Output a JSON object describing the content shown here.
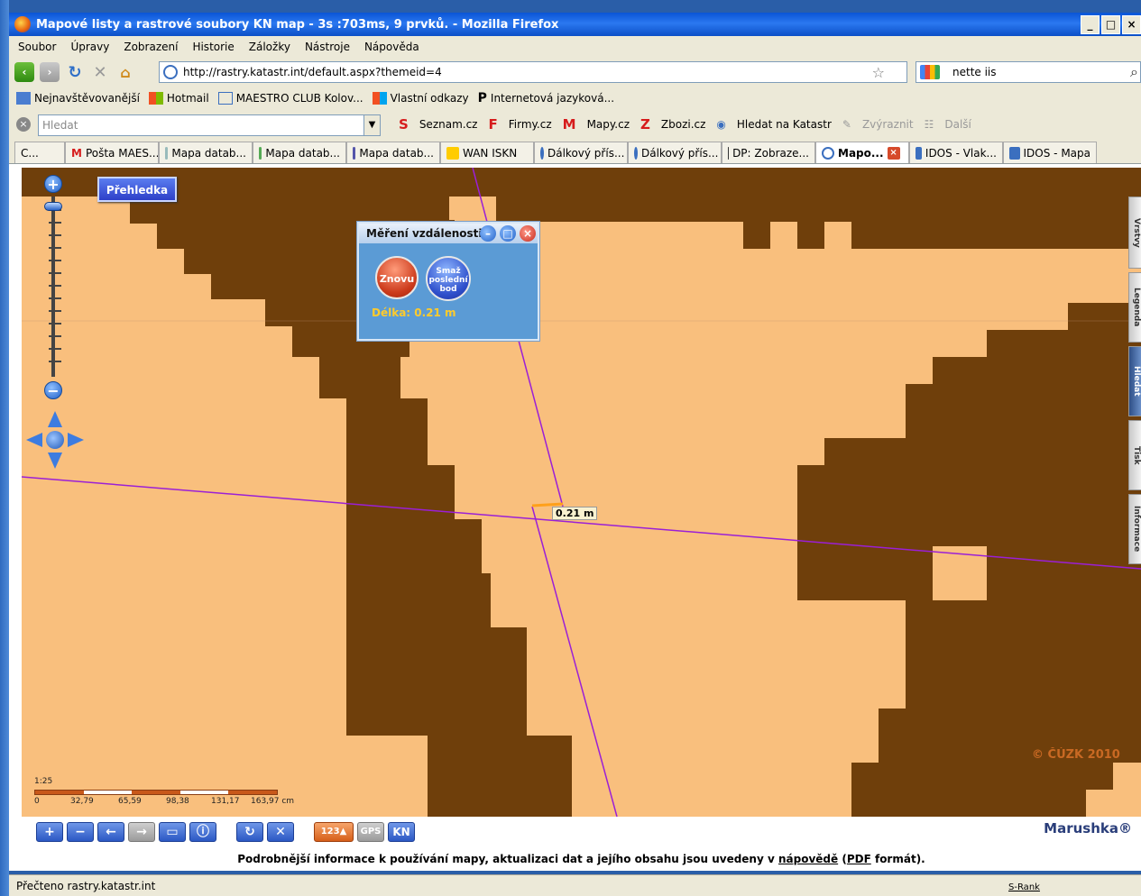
{
  "window": {
    "title": "Mapové listy a rastrové soubory KN map - 3s :703ms, 9 prvků. - Mozilla Firefox",
    "controls": [
      "_",
      "□",
      "×"
    ]
  },
  "menu": [
    "Soubor",
    "Úpravy",
    "Zobrazení",
    "Historie",
    "Záložky",
    "Nástroje",
    "Nápověda"
  ],
  "nav": {
    "url": "http://rastry.katastr.int/default.aspx?themeid=4",
    "search_value": "nette iis"
  },
  "bookmarks": [
    "Nejnavštěvovanější",
    "Hotmail",
    "MAESTRO CLUB Kolov...",
    "Vlastní odkazy",
    "Internetová jazyková..."
  ],
  "toolbar2": {
    "search_placeholder": "Hledat",
    "items": [
      "Seznam.cz",
      "Firmy.cz",
      "Mapy.cz",
      "Zbozi.cz",
      "Hledat na Katastr",
      "Zvýraznit",
      "Další"
    ]
  },
  "tabs": [
    {
      "label": "C...",
      "active": false
    },
    {
      "label": "Pošta MAES...",
      "active": false
    },
    {
      "label": "Mapa datab...",
      "active": false
    },
    {
      "label": "Mapa datab...",
      "active": false
    },
    {
      "label": "Mapa datab...",
      "active": false
    },
    {
      "label": "WAN ISKN",
      "active": false
    },
    {
      "label": "Dálkový přís...",
      "active": false
    },
    {
      "label": "Dálkový přís...",
      "active": false
    },
    {
      "label": "DP: Zobraze...",
      "active": false
    },
    {
      "label": "Mapo...",
      "active": true
    },
    {
      "label": "IDOS - Vlak...",
      "active": false
    },
    {
      "label": "IDOS - Mapa",
      "active": false
    }
  ],
  "map": {
    "overview_button": "Přehledka",
    "measure_panel": {
      "title": "Měření vzdálenosti",
      "again_button": "Znovu",
      "delete_last_button": "Smaž poslední bod",
      "length_text": "Délka: 0.21 m"
    },
    "measure_label": "0.21 m",
    "scale": {
      "ratio": "1:25",
      "labels": [
        "0",
        "32,79",
        "65,59",
        "98,38",
        "131,17",
        "163,97 cm"
      ]
    },
    "copyright": "© ČÚZK 2010",
    "side_tabs": [
      "Vrstvy",
      "Legenda",
      "Hledat",
      "Tisk",
      "Informace"
    ],
    "colors": {
      "land": "#f9bf7d",
      "parcel": "#6f3f0b",
      "line": "#9b1fd6"
    }
  },
  "bottom": {
    "buttons": [
      "zoom-in",
      "zoom-out",
      "back",
      "forward",
      "zoom-extent",
      "info",
      "refresh",
      "clear",
      "measure",
      "GPS",
      "KN"
    ],
    "brand": "Marushka®",
    "info_text_pre": "Podrobnější informace k používání mapy, aktualizaci dat a jejího obsahu jsou uvedeny v",
    "info_link1": "nápovědě",
    "info_paren_open": "(",
    "info_link2": "PDF",
    "info_text_post": "formát)."
  },
  "status": {
    "text": "Přečteno rastry.katastr.int",
    "srank": "S-Rank"
  }
}
